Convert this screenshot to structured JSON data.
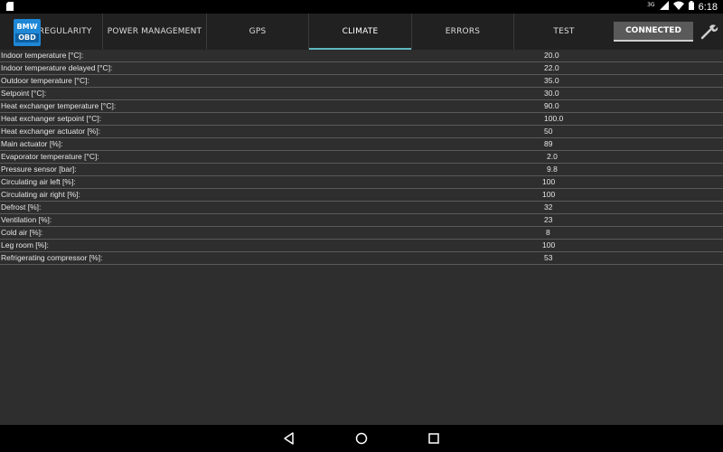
{
  "status_bar": {
    "network": "3G",
    "time": "6:18"
  },
  "app": {
    "logo_top": "BMW",
    "logo_bottom": "OBD"
  },
  "tabs": [
    {
      "label": "IRREGULARITY"
    },
    {
      "label": "POWER MANAGEMENT"
    },
    {
      "label": "GPS"
    },
    {
      "label": "CLIMATE",
      "active": true
    },
    {
      "label": "ERRORS"
    },
    {
      "label": "TEST"
    }
  ],
  "connection": {
    "label": "CONNECTED"
  },
  "rows": [
    {
      "label": "Indoor temperature [°C]:",
      "value": "20.0"
    },
    {
      "label": "Indoor temperature delayed [°C]:",
      "value": "22.0"
    },
    {
      "label": "Outdoor temperature [°C]:",
      "value": "35.0"
    },
    {
      "label": "Setpoint [°C]:",
      "value": "30.0"
    },
    {
      "label": "Heat exchanger temperature [°C]:",
      "value": "90.0"
    },
    {
      "label": "Heat exchanger setpoint [°C]:",
      "value": "100.0"
    },
    {
      "label": "Heat exchanger actuator [%]:",
      "value": "50"
    },
    {
      "label": "Main actuator [%]:",
      "value": "89"
    },
    {
      "label": "Evaporator temperature [°C]:",
      "value": "2.0"
    },
    {
      "label": "Pressure sensor [bar]:",
      "value": "9.8"
    },
    {
      "label": "Circulating air left [%]:",
      "value": "100"
    },
    {
      "label": "Circulating air right [%]:",
      "value": "100"
    },
    {
      "label": "Defrost [%]:",
      "value": "32"
    },
    {
      "label": "Ventilation [%]:",
      "value": "23"
    },
    {
      "label": "Cold air [%]:",
      "value": "8"
    },
    {
      "label": "Leg room [%]:",
      "value": "100"
    },
    {
      "label": "Refrigerating compressor [%]:",
      "value": "53"
    }
  ],
  "colors": {
    "accent": "#5fb7bf",
    "background": "#2e2e2e",
    "actionbar": "#212121",
    "logo": "#1e87d6"
  },
  "icons": {
    "status_left": "sd-card-icon",
    "signal": "signal-icon",
    "wifi": "wifi-icon",
    "battery": "battery-icon",
    "settings": "wrench-icon",
    "nav_back": "back-icon",
    "nav_home": "home-icon",
    "nav_recents": "recents-icon"
  }
}
